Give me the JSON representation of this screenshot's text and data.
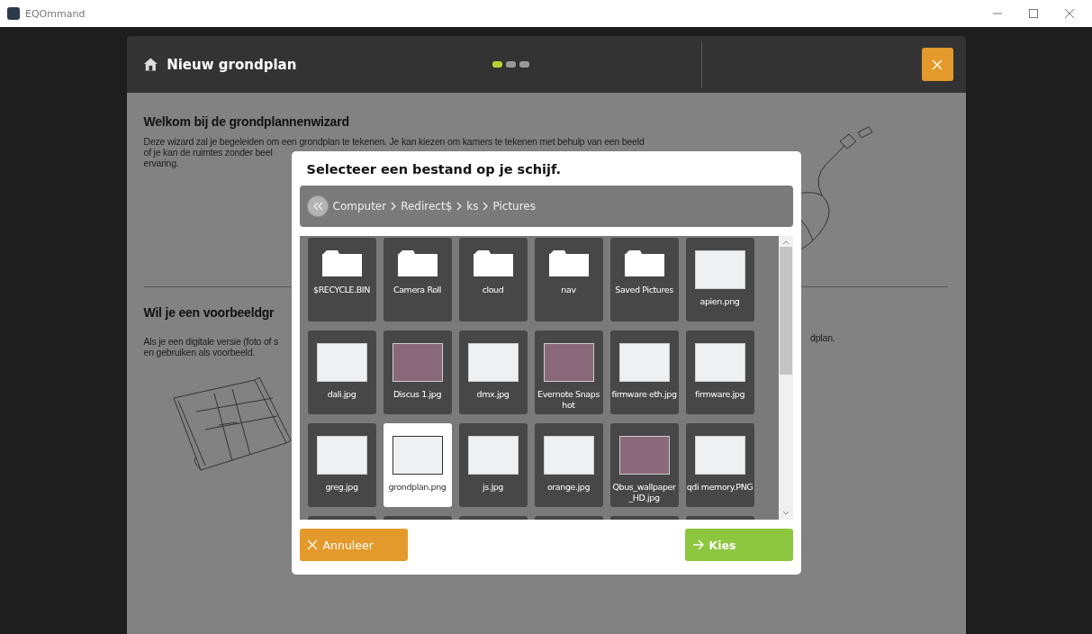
{
  "app_title": "EQOmmand",
  "header": {
    "title": "Nieuw grondplan",
    "steps": [
      {
        "selected": true
      },
      {
        "selected": false
      },
      {
        "selected": false
      }
    ]
  },
  "intro": {
    "heading": "Welkom bij de grondplannenwizard",
    "lines": [
      "Deze wizard zal je begeleiden om een grondplan te tekenen. Je kan kiezen om kamers te tekenen met behulp van een beeld",
      "of je kan de ruimtes zonder beel",
      "ervaring."
    ]
  },
  "example": {
    "heading": "Wil je een voorbeeldgr",
    "lines": [
      "Als je een digitale versie (foto of s",
      "en gebruiken als voorbeeld."
    ],
    "right_text": "dplan."
  },
  "dialog": {
    "title": "Selecteer een bestand op je schijf.",
    "path": [
      "Computer",
      "Redirect$",
      "ks",
      "Pictures"
    ],
    "files": [
      {
        "name": "$RECYCLE.BIN",
        "kind": "folder",
        "selected": false
      },
      {
        "name": "Camera Roll",
        "kind": "folder",
        "selected": false
      },
      {
        "name": "cloud",
        "kind": "folder",
        "selected": false
      },
      {
        "name": "nav",
        "kind": "folder",
        "selected": false
      },
      {
        "name": "Saved Pictures",
        "kind": "folder",
        "selected": false
      },
      {
        "name": "apien.png",
        "kind": "screenshot",
        "selected": false
      },
      {
        "name": "dali.jpg",
        "kind": "screenshot",
        "selected": false
      },
      {
        "name": "Discus 1.jpg",
        "kind": "photo",
        "selected": false
      },
      {
        "name": "dmx.jpg",
        "kind": "screenshot",
        "selected": false
      },
      {
        "name": "Evernote Snapshot",
        "kind": "photo",
        "selected": false
      },
      {
        "name": "firmware eth.jpg",
        "kind": "screenshot",
        "selected": false
      },
      {
        "name": "firmware.jpg",
        "kind": "screenshot",
        "selected": false
      },
      {
        "name": "greg.jpg",
        "kind": "screenshot",
        "selected": false
      },
      {
        "name": "grondplan.png",
        "kind": "screenshot",
        "selected": true
      },
      {
        "name": "js.jpg",
        "kind": "screenshot",
        "selected": false
      },
      {
        "name": "orange.jpg",
        "kind": "screenshot",
        "selected": false
      },
      {
        "name": "Qbus_wallpaper_HD.jpg",
        "kind": "photo",
        "selected": false
      },
      {
        "name": "qdi memory.PNG",
        "kind": "screenshot",
        "selected": false
      }
    ],
    "cancel": "Annuleer",
    "confirm": "Kies"
  }
}
